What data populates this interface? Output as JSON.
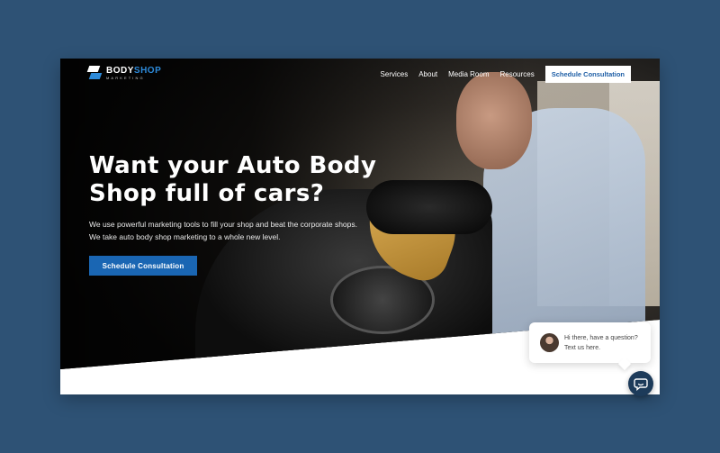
{
  "brand": {
    "name_part1": "BODY",
    "name_part2": "SHOP",
    "tagline": "MARKETING"
  },
  "nav": {
    "items": [
      "Services",
      "About",
      "Media Room",
      "Resources"
    ],
    "cta_label": "Schedule Consultation"
  },
  "hero": {
    "title": "Want your Auto Body Shop full of cars?",
    "subtitle_line1": "We use powerful marketing tools to fill your shop and beat the corporate shops.",
    "subtitle_line2": "We take auto body shop marketing to a whole new level.",
    "cta_label": "Schedule Consultation"
  },
  "chat": {
    "message": "Hi there, have a question? Text us here.",
    "button_icon": "chat-icon"
  },
  "colors": {
    "page_background": "#2e5275",
    "accent": "#1a66b3",
    "chat_button": "#1d3b5a"
  }
}
